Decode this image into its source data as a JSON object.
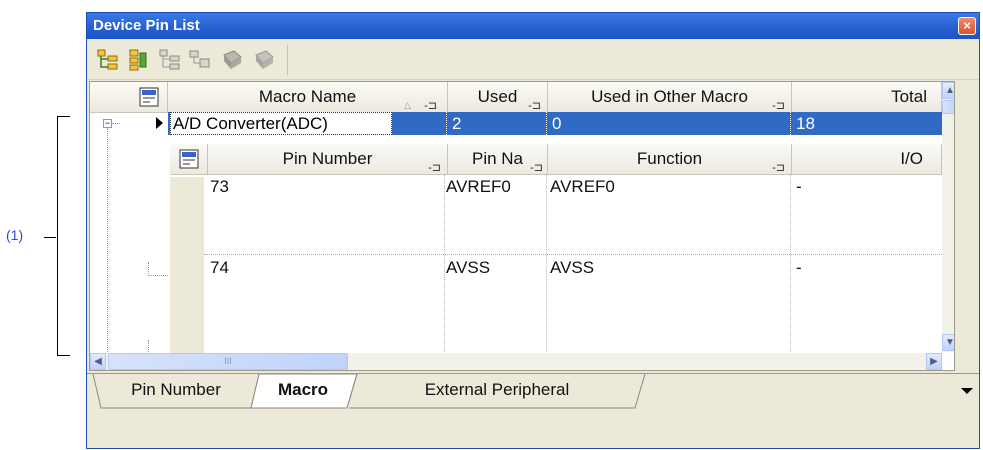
{
  "callout": {
    "label": "(1)"
  },
  "window": {
    "title": "Device Pin List",
    "close_icon": "close-icon"
  },
  "toolbar": {
    "buttons": [
      "expand-all-icon",
      "collapse-all-icon",
      "show-used-icon",
      "hide-unused-icon",
      "chip-view-icon",
      "chip-view-alt-icon"
    ]
  },
  "macro_table": {
    "headers": [
      "Macro Name",
      "Used",
      "Used in Other Macro",
      "Total"
    ],
    "row": {
      "macro_name": "A/D Converter(ADC)",
      "used": "2",
      "used_in_other": "0",
      "total": "18"
    }
  },
  "pin_table": {
    "headers": [
      "Pin Number",
      "Pin Na",
      "Function",
      "I/O"
    ],
    "rows": [
      {
        "pin_number": "73",
        "pin_name": "AVREF0",
        "function": "AVREF0",
        "io": "-"
      },
      {
        "pin_number": "74",
        "pin_name": "AVSS",
        "function": "AVSS",
        "io": "-"
      }
    ]
  },
  "tabs": [
    "Pin Number",
    "Macro",
    "External Peripheral"
  ],
  "active_tab": "Macro",
  "scroll": {
    "hscroll_thumb_label": "III"
  }
}
